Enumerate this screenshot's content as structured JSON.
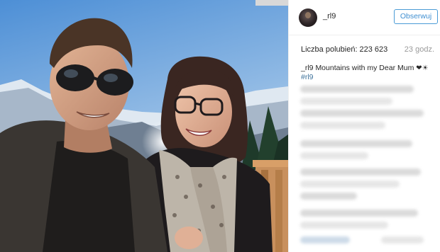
{
  "post": {
    "username": "_rl9",
    "follow_label": "Obserwuj",
    "likes_label": "Liczba polubień:",
    "likes_count": "223 623",
    "time_ago": "23 godz.",
    "caption_user": "_rl9",
    "caption_text": "Mountains with my Dear Mum",
    "caption_emoji": "❤☀",
    "hashtag": "#rl9"
  },
  "photo": {
    "description_icon": "selfie-photo"
  },
  "colors": {
    "follow": "#3f8fd1",
    "hashtag": "#3f729b"
  }
}
